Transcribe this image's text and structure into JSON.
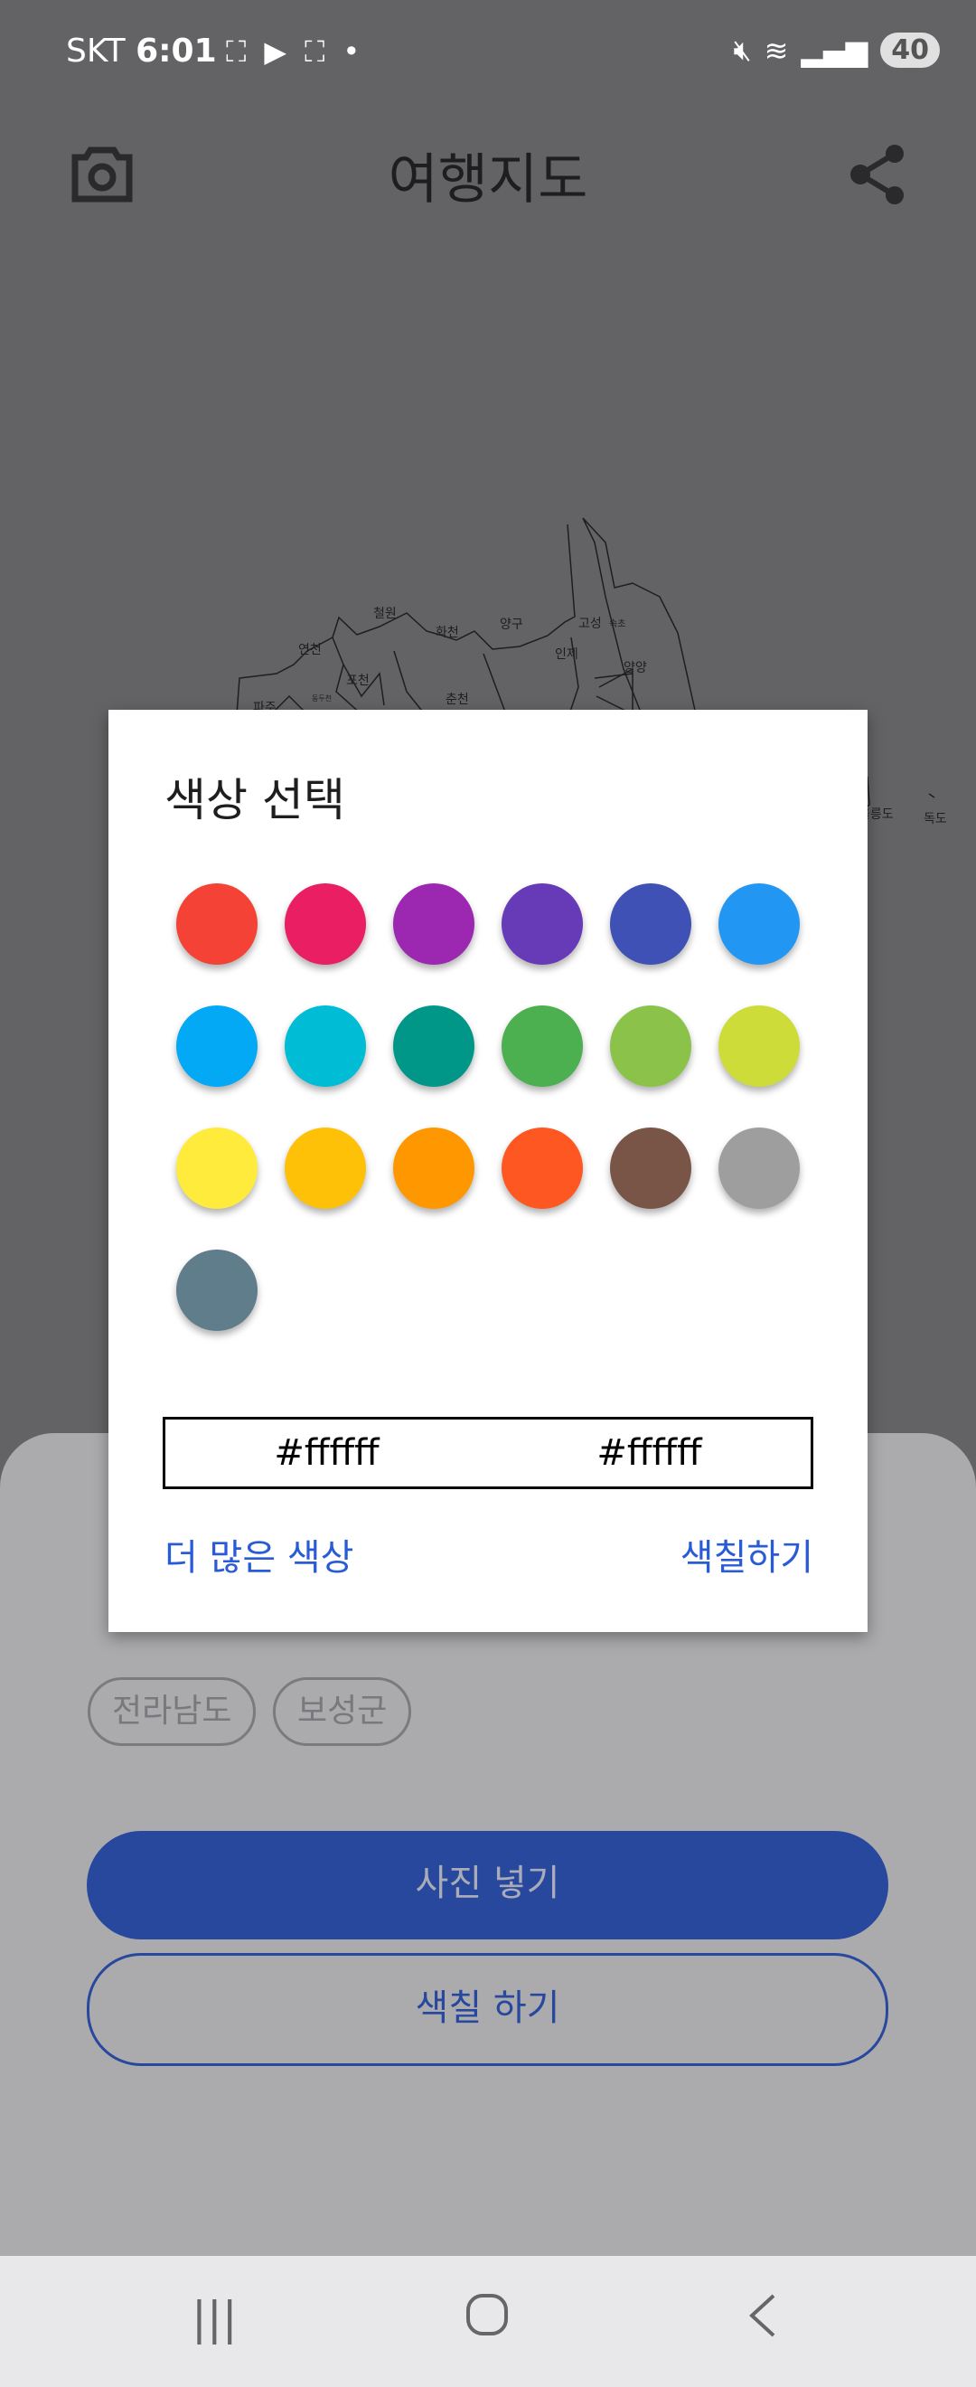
{
  "status_bar": {
    "carrier": "SKT",
    "time": "6:01",
    "battery": "40"
  },
  "app_bar": {
    "title": "여행지도"
  },
  "map": {
    "labels": [
      "고성",
      "속초",
      "철원",
      "화천",
      "양구",
      "인제",
      "연천",
      "포천",
      "양양",
      "춘천",
      "파주",
      "동두천",
      "울릉도",
      "독도"
    ]
  },
  "sheet": {
    "chips": [
      "전라남도",
      "보성군"
    ],
    "primary_button": "사진 넣기",
    "secondary_button": "색칠 하기"
  },
  "dialog": {
    "title": "색상 선택",
    "colors": [
      "#F44336",
      "#E91E63",
      "#9C27B0",
      "#673AB7",
      "#3F51B5",
      "#2196F3",
      "#03A9F4",
      "#00BCD4",
      "#009688",
      "#4CAF50",
      "#8BC34A",
      "#CDDC39",
      "#FFEB3B",
      "#FFC107",
      "#FF9800",
      "#FF5722",
      "#795548",
      "#9E9E9E",
      "#607D8B"
    ],
    "hex_left": "#ffffff",
    "hex_right": "#ffffff",
    "more_colors": "더 많은 색상",
    "apply": "색칠하기"
  }
}
